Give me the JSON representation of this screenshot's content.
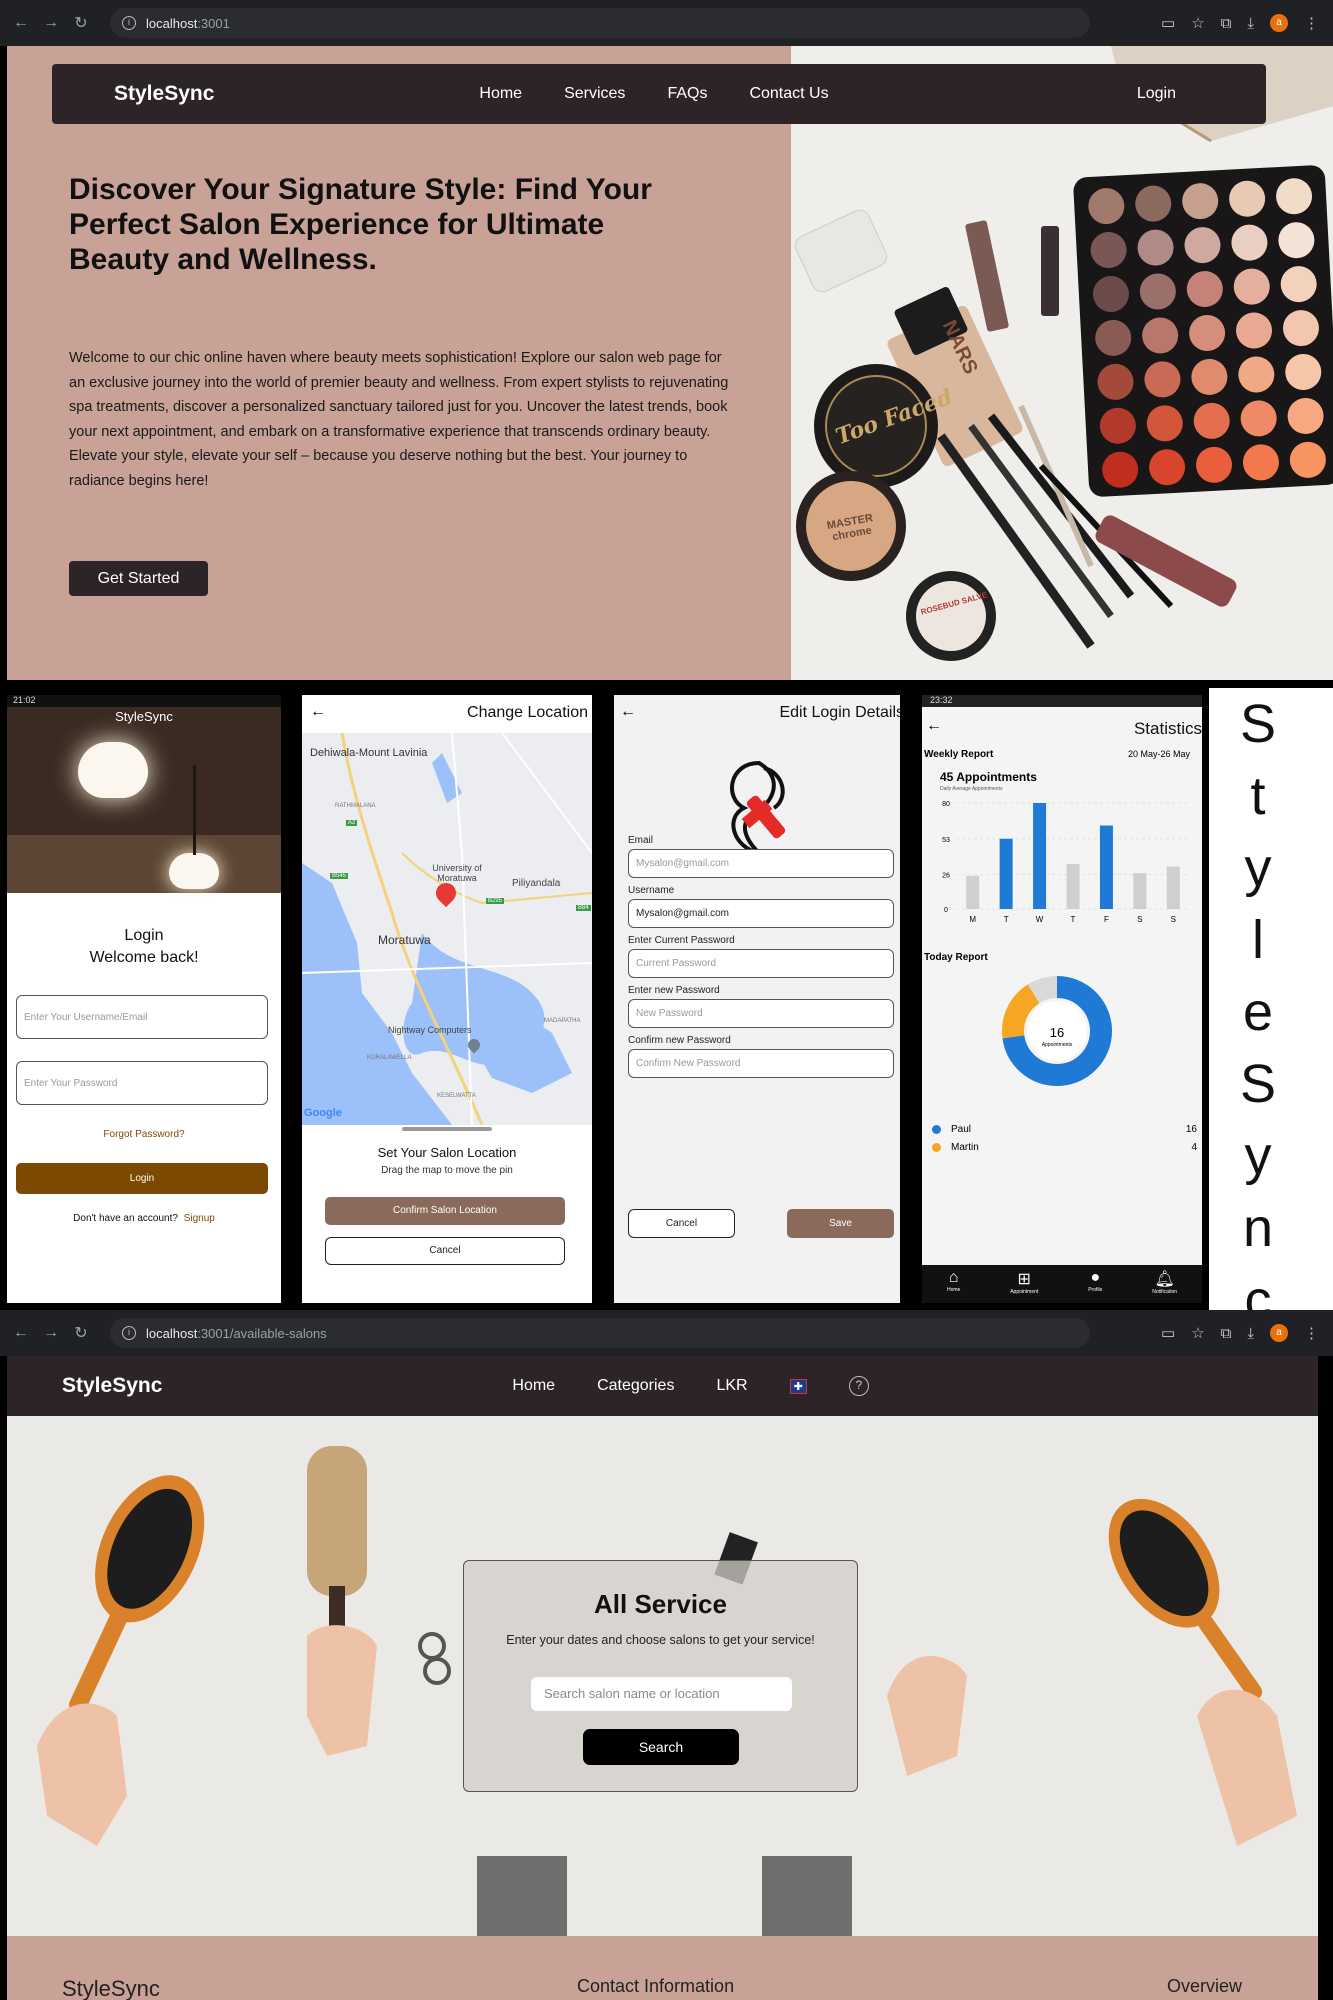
{
  "browser1": {
    "url_host": "localhost",
    "url_rest": ":3001"
  },
  "hero": {
    "brand": "StyleSync",
    "nav": [
      "Home",
      "Services",
      "FAQs",
      "Contact Us"
    ],
    "login": "Login",
    "heading": "Discover Your Signature Style: Find Your Perfect Salon Experience for Ultimate Beauty and Wellness.",
    "body": "Welcome to our chic online haven where beauty meets sophistication! Explore our salon web page for an exclusive journey into the world of premier beauty and wellness. From expert stylists to rejuvenating spa treatments, discover a personalized sanctuary tailored just for you. Uncover the latest trends, book your next appointment, and embark on a transformative experience that transcends ordinary beauty. Elevate your style, elevate your self – because you deserve nothing but the best. Your journey to radiance begins here!",
    "cta": "Get Started",
    "product_labels": {
      "too_faced": "Too Faced",
      "nars": "NARS",
      "master": "MASTER chrome",
      "rosebud": "ROSEBUD SALVE"
    }
  },
  "login_phone": {
    "status_time": "21:02",
    "brand": "StyleSync",
    "title": "Login",
    "welcome": "Welcome back!",
    "username_placeholder": "Enter Your Username/Email",
    "password_placeholder": "Enter Your Password",
    "forgot": "Forgot Password?",
    "login_btn": "Login",
    "no_account": "Don't have an account?",
    "signup": "Signup"
  },
  "location_phone": {
    "title": "Change Location",
    "places": [
      "Dehiwala-Mount Lavinia",
      "University of Moratuwa",
      "Piliyandala",
      "Moratuwa",
      "Nightway Computers",
      "RATHMALANA",
      "KORALAWELLA",
      "KESELWATTA",
      "MADAPATHA"
    ],
    "road_codes": [
      "A2",
      "B545",
      "B295",
      "B84"
    ],
    "google": "Google",
    "heading": "Set Your Salon Location",
    "hint": "Drag the map to move the pin",
    "confirm": "Confirm Salon Location",
    "cancel": "Cancel"
  },
  "edit_phone": {
    "title": "Edit Login Details",
    "fields": [
      {
        "label": "Email",
        "value": "Mysalon@gmail.com",
        "filled": false
      },
      {
        "label": "Username",
        "value": "Mysalon@gmail.com",
        "filled": true
      },
      {
        "label": "Enter Current Password",
        "value": "Current Password",
        "filled": false
      },
      {
        "label": "Enter new Password",
        "value": "New Password",
        "filled": false
      },
      {
        "label": "Confirm new Password",
        "value": "Confirm New Password",
        "filled": false
      }
    ],
    "cancel": "Cancel",
    "save": "Save"
  },
  "stats_phone": {
    "status_time": "23:32",
    "title": "Statistics",
    "weekly": "Weekly Report",
    "range": "20 May-26 May",
    "appointments": "45 Appointments",
    "daily_avg": "Daily Average Appointments",
    "today": "Today Report",
    "donut_value": "16",
    "donut_label": "Appointments",
    "legend": [
      {
        "name": "Paul",
        "value": "16",
        "color": "#1e7ad4"
      },
      {
        "name": "Martin",
        "value": "4",
        "color": "#f5a623"
      }
    ],
    "tabs": [
      "Home",
      "Appointment",
      "Profile",
      "Notification"
    ]
  },
  "chart_data": {
    "type": "bar",
    "categories": [
      "M",
      "T",
      "W",
      "T",
      "F",
      "S",
      "S"
    ],
    "values": [
      25,
      53,
      80,
      34,
      63,
      27,
      32
    ],
    "highlighted": [
      false,
      true,
      true,
      false,
      true,
      false,
      false
    ],
    "yticks": [
      0,
      26,
      53,
      80
    ],
    "ylim": [
      0,
      80
    ],
    "colors": {
      "highlight": "#1e7ad4",
      "normal": "#cfcfcf"
    }
  },
  "side_letters": [
    "S",
    "t",
    "y",
    "l",
    "e",
    "S",
    "y",
    "n",
    "c"
  ],
  "browser2": {
    "url_host": "localhost",
    "url_rest": ":3001/available-salons"
  },
  "salons": {
    "brand": "StyleSync",
    "nav": [
      "Home",
      "Categories",
      "LKR"
    ],
    "title": "All Service",
    "subtitle": "Enter your dates and choose salons to get your service!",
    "search_placeholder": "Search salon name or location",
    "search_btn": "Search",
    "footer": [
      "StyleSync",
      "Contact Information",
      "Overview"
    ]
  },
  "colors": {
    "brand_dark": "#2d2427",
    "rose": "#c8a296",
    "brown": "#7b5200",
    "taupe": "#8a6a5b"
  }
}
